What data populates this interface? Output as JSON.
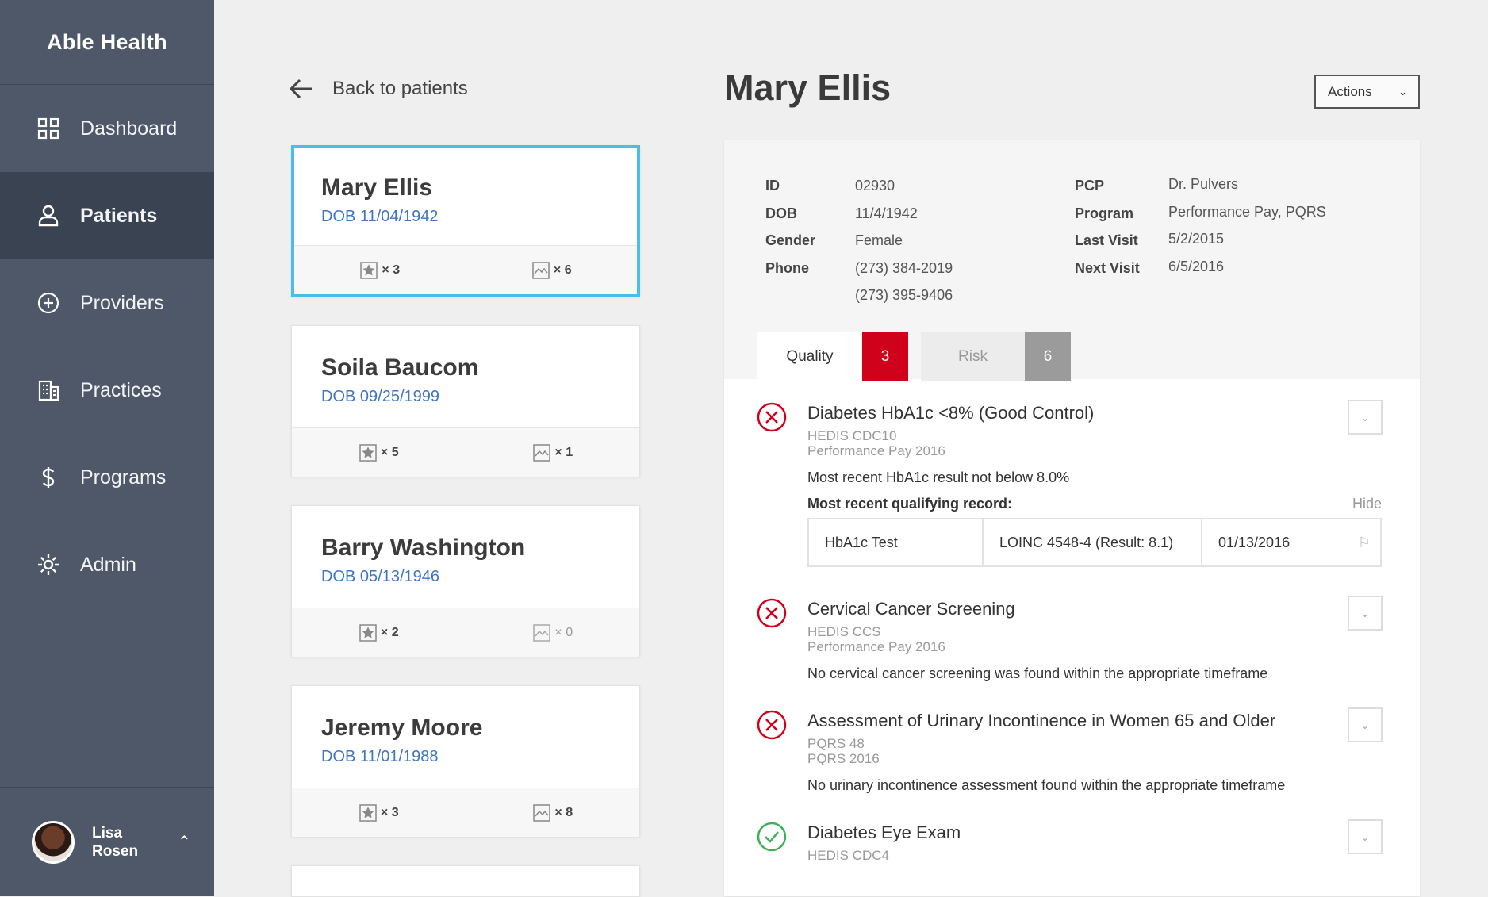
{
  "app": {
    "brand": "Able Health"
  },
  "sidebar": {
    "items": [
      {
        "label": "Dashboard",
        "icon": "grid-icon"
      },
      {
        "label": "Patients",
        "icon": "person-icon"
      },
      {
        "label": "Providers",
        "icon": "plus-circle-icon"
      },
      {
        "label": "Practices",
        "icon": "building-icon"
      },
      {
        "label": "Programs",
        "icon": "dollar-icon"
      },
      {
        "label": "Admin",
        "icon": "gear-icon"
      }
    ],
    "active": "Patients",
    "user": {
      "name": "Lisa Rosen",
      "first": "Lisa",
      "last": "Rosen"
    }
  },
  "back_label": "Back to patients",
  "patients": [
    {
      "name": "Mary Ellis",
      "dob": "DOB 11/04/1942",
      "quality": "× 3",
      "risk": "× 6",
      "selected": true
    },
    {
      "name": "Soila Baucom",
      "dob": "DOB 09/25/1999",
      "quality": "× 5",
      "risk": "× 1"
    },
    {
      "name": "Barry Washington",
      "dob": "DOB 05/13/1946",
      "quality": "× 2",
      "risk": "× 0"
    },
    {
      "name": "Jeremy Moore",
      "dob": "DOB 11/01/1988",
      "quality": "× 3",
      "risk": "× 8"
    }
  ],
  "detail": {
    "title": "Mary Ellis",
    "actions_label": "Actions",
    "labels": {
      "id": "ID",
      "dob": "DOB",
      "gender": "Gender",
      "phone": "Phone",
      "pcp": "PCP",
      "program": "Program",
      "last_visit": "Last Visit",
      "next_visit": "Next Visit"
    },
    "values": {
      "id": "02930",
      "dob": "11/4/1942",
      "gender": "Female",
      "phone1": "(273) 384-2019",
      "phone2": "(273) 395-9406",
      "pcp": "Dr. Pulvers",
      "program": "Performance Pay, PQRS",
      "last_visit": "5/2/2015",
      "next_visit": "6/5/2016"
    },
    "tabs": {
      "quality": "Quality",
      "quality_count": "3",
      "risk": "Risk",
      "risk_count": "6"
    },
    "measures": [
      {
        "title": "Diabetes HbA1c <8% (Good Control)",
        "code": "HEDIS CDC10",
        "program": "Performance Pay 2016",
        "desc": "Most recent HbA1c result not below 8.0%",
        "status": "fail",
        "record": {
          "heading": "Most recent qualifying record:",
          "hide": "Hide",
          "test": "HbA1c Test",
          "loinc": "LOINC 4548-4 (Result: 8.1)",
          "date": "01/13/2016"
        }
      },
      {
        "title": "Cervical Cancer Screening",
        "code": "HEDIS CCS",
        "program": "Performance Pay 2016",
        "desc": "No cervical cancer screening was found within the appropriate timeframe",
        "status": "fail"
      },
      {
        "title": "Assessment of Urinary Incontinence in Women 65 and Older",
        "code": "PQRS 48",
        "program": "PQRS 2016",
        "desc": "No urinary incontinence assessment found within the appropriate timeframe",
        "status": "fail"
      },
      {
        "title": "Diabetes Eye Exam",
        "code": "HEDIS CDC4",
        "status": "pass"
      }
    ]
  },
  "colors": {
    "sidebar": "#4e5868",
    "sidebar_active": "#3a4352",
    "selected_border": "#4cbde8",
    "link": "#3f76c4",
    "fail": "#d0021b",
    "pass": "#3fae5a"
  }
}
